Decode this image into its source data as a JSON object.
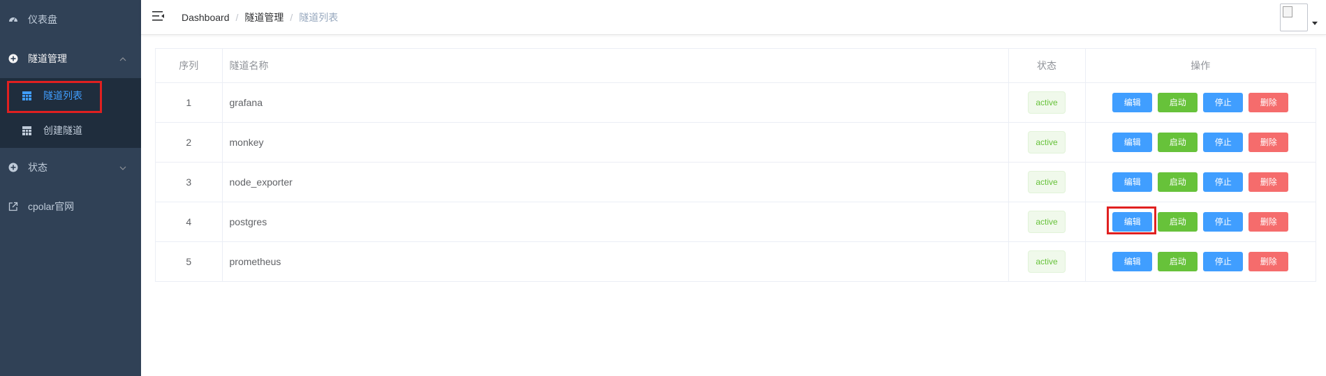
{
  "sidebar": {
    "dashboard": "仪表盘",
    "tunnel_mgmt": "隧道管理",
    "tunnel_list": "隧道列表",
    "create_tunnel": "创建隧道",
    "status": "状态",
    "website": "cpolar官网"
  },
  "breadcrumb": {
    "home": "Dashboard",
    "parent": "隧道管理",
    "current": "隧道列表",
    "separator": "/"
  },
  "table": {
    "headers": {
      "index": "序列",
      "name": "隧道名称",
      "status": "状态",
      "ops": "操作"
    },
    "rows": [
      {
        "index": "1",
        "name": "grafana",
        "status": "active"
      },
      {
        "index": "2",
        "name": "monkey",
        "status": "active"
      },
      {
        "index": "3",
        "name": "node_exporter",
        "status": "active"
      },
      {
        "index": "4",
        "name": "postgres",
        "status": "active"
      },
      {
        "index": "5",
        "name": "prometheus",
        "status": "active"
      }
    ],
    "actions": {
      "edit": "编辑",
      "start": "启动",
      "stop": "停止",
      "delete": "删除"
    }
  },
  "colors": {
    "sidebar_bg": "#304156",
    "submenu_bg": "#1f2d3d",
    "active_text": "#409eff",
    "primary": "#409eff",
    "success": "#67c23a",
    "danger": "#f56c6c",
    "highlight": "#e02020"
  }
}
